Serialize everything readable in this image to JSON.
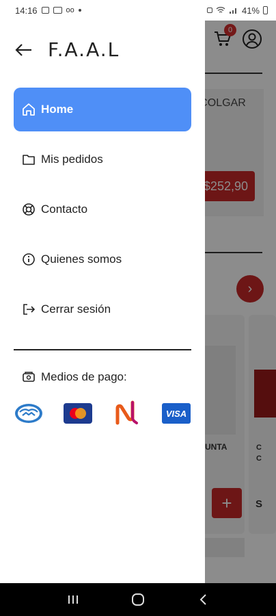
{
  "status_bar": {
    "time": "14:16",
    "battery": "41%"
  },
  "background": {
    "cart_count": "0",
    "banner_text": "A COLGAR",
    "price": "$252,90",
    "card_text": "UNTA",
    "card2_text_1": "C",
    "card2_text_2": "C",
    "add_label": "+",
    "card2_letter": "S"
  },
  "drawer": {
    "brand": "F.A.A.L",
    "menu": [
      {
        "label": "Home",
        "icon": "home-icon",
        "active": true
      },
      {
        "label": "Mis pedidos",
        "icon": "folder-icon",
        "active": false
      },
      {
        "label": "Contacto",
        "icon": "lifebuoy-icon",
        "active": false
      },
      {
        "label": "Quienes somos",
        "icon": "info-icon",
        "active": false
      },
      {
        "label": "Cerrar sesión",
        "icon": "logout-icon",
        "active": false
      }
    ],
    "payment_title": "Medios de pago:",
    "payment_methods": [
      "Mercado Pago",
      "Mastercard",
      "Naranja",
      "VISA"
    ]
  },
  "colors": {
    "accent": "#4f8ff7",
    "brand_red": "#c62828"
  }
}
